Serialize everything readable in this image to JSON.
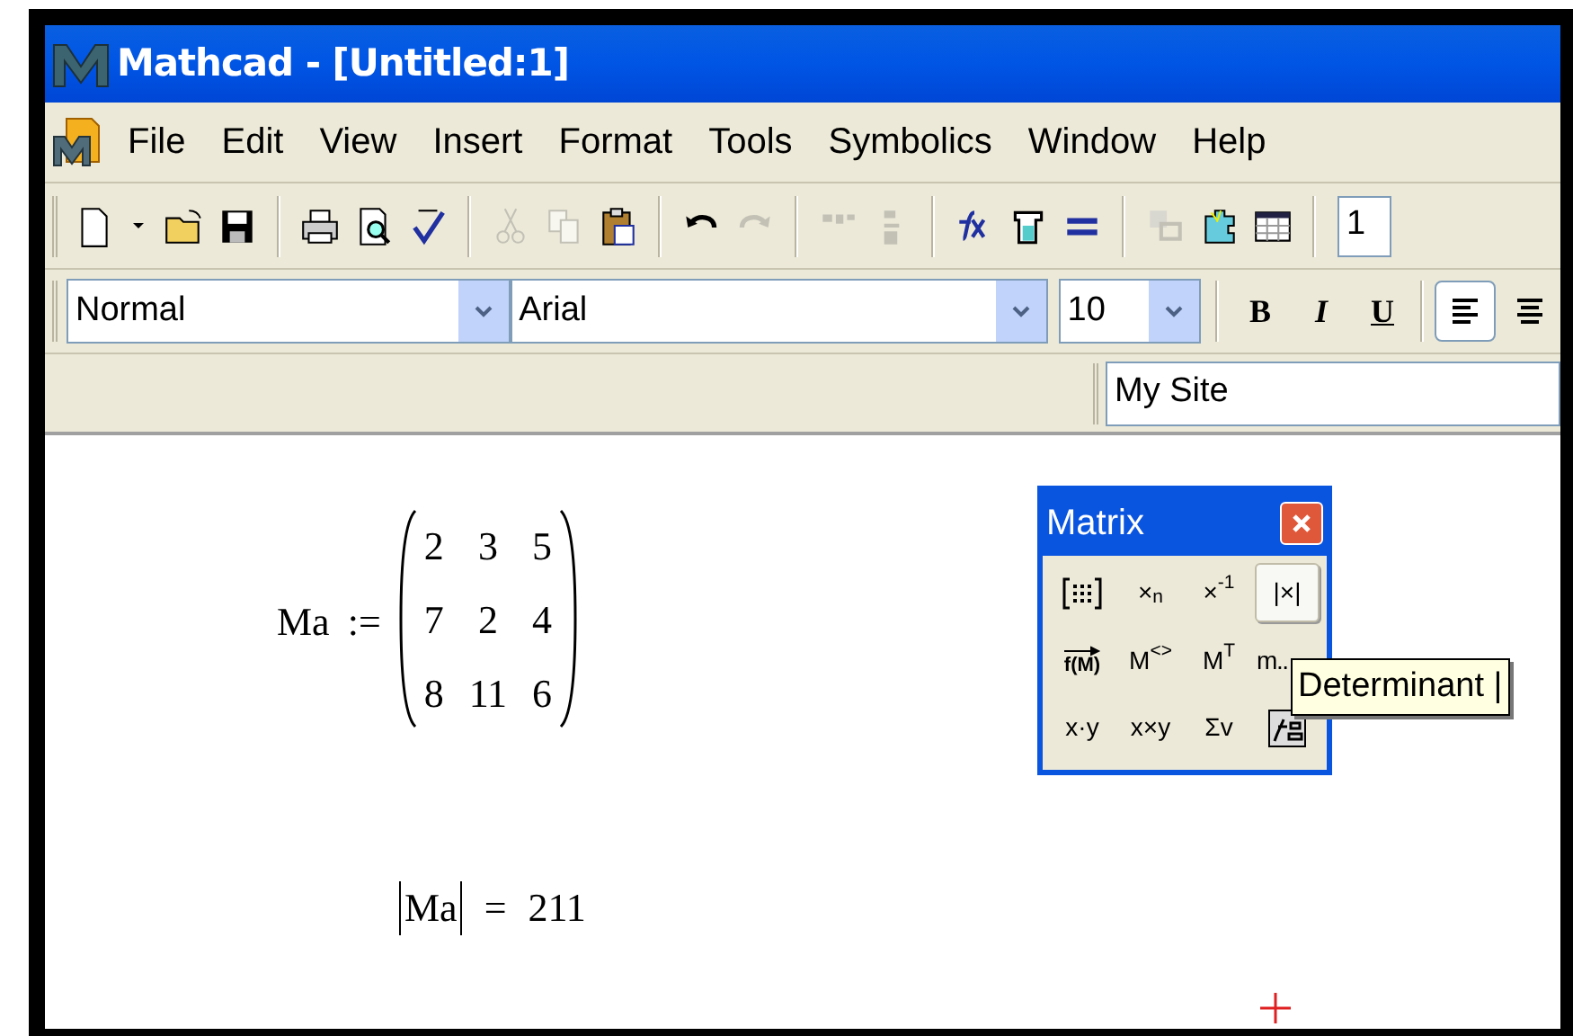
{
  "window": {
    "title": "Mathcad - [Untitled:1]"
  },
  "menu": [
    "File",
    "Edit",
    "View",
    "Insert",
    "Format",
    "Tools",
    "Symbolics",
    "Window",
    "Help"
  ],
  "standard_toolbar": [
    {
      "kind": "new",
      "disabled": false
    },
    {
      "kind": "dropdown",
      "disabled": false
    },
    {
      "kind": "open",
      "disabled": false
    },
    {
      "kind": "save",
      "disabled": false
    },
    {
      "kind": "sep"
    },
    {
      "kind": "print",
      "disabled": false
    },
    {
      "kind": "preview",
      "disabled": false
    },
    {
      "kind": "spell",
      "disabled": false
    },
    {
      "kind": "sep"
    },
    {
      "kind": "cut",
      "disabled": true
    },
    {
      "kind": "copy",
      "disabled": true
    },
    {
      "kind": "paste",
      "disabled": false
    },
    {
      "kind": "sep"
    },
    {
      "kind": "undo",
      "disabled": false
    },
    {
      "kind": "redo",
      "disabled": true
    },
    {
      "kind": "sep"
    },
    {
      "kind": "align-across",
      "disabled": true
    },
    {
      "kind": "align-down",
      "disabled": true
    },
    {
      "kind": "sep"
    },
    {
      "kind": "function",
      "disabled": false
    },
    {
      "kind": "unit",
      "disabled": false
    },
    {
      "kind": "equals",
      "disabled": false
    },
    {
      "kind": "sep"
    },
    {
      "kind": "component",
      "disabled": true
    },
    {
      "kind": "resources",
      "disabled": false
    },
    {
      "kind": "table",
      "disabled": false
    },
    {
      "kind": "sep"
    }
  ],
  "zoom_field": {
    "value": "1"
  },
  "formatting_toolbar": {
    "style": "Normal",
    "font": "Arial",
    "size": "10",
    "styles": [
      {
        "label": "B",
        "kind": "bold",
        "selected": false
      },
      {
        "label": "I",
        "kind": "italic",
        "selected": false
      },
      {
        "label": "U",
        "kind": "underline",
        "selected": false
      }
    ],
    "alignment": [
      {
        "kind": "left",
        "selected": true
      },
      {
        "kind": "center",
        "selected": false
      }
    ]
  },
  "resource_toolbar": {
    "address": "My Site"
  },
  "worksheet": {
    "definition": {
      "name": "Ma",
      "operator": ":=",
      "matrix": [
        [
          "2",
          "3",
          "5"
        ],
        [
          "7",
          "2",
          "4"
        ],
        [
          "8",
          "11",
          "6"
        ]
      ]
    },
    "evaluation": {
      "expression": "Ma",
      "operator": "=",
      "result": "211"
    }
  },
  "matrix_palette": {
    "title": "Matrix",
    "buttons": [
      {
        "kind": "matrix",
        "selected": false
      },
      {
        "kind": "text",
        "label": "×$_{n}$",
        "selected": false
      },
      {
        "kind": "text",
        "label": "×$^{-1}$",
        "selected": false
      },
      {
        "kind": "text",
        "label": "|×|",
        "selected": true
      },
      {
        "kind": "vectorize",
        "label": "f(M)",
        "selected": false
      },
      {
        "kind": "text",
        "label": "M$^{<>}$",
        "selected": false
      },
      {
        "kind": "text",
        "label": "M$^{T}$",
        "selected": false
      },
      {
        "kind": "text",
        "label": "m..",
        "selected": false
      },
      {
        "kind": "text",
        "label": "x·y",
        "selected": false
      },
      {
        "kind": "text",
        "label": "x×y",
        "selected": false
      },
      {
        "kind": "text",
        "label": "Σv",
        "selected": false
      },
      {
        "kind": "picture",
        "selected": false
      }
    ]
  },
  "tooltip": "Determinant |"
}
